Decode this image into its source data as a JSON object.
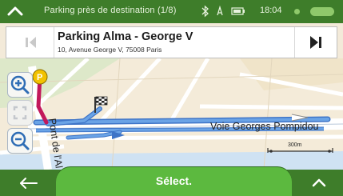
{
  "status_bar": {
    "title": "Parking près de destination (1/8)",
    "time": "18:04",
    "icons": [
      "chevron-up-icon",
      "bluetooth-icon",
      "gps-icon",
      "battery-icon",
      "gps-status-dot",
      "signal-pill"
    ]
  },
  "poi": {
    "name": "Parking Alma - George V",
    "address": "10, Avenue George V, 75008 Paris"
  },
  "map": {
    "road_label_horizontal": "Voie Georges Pompidou",
    "road_label_vertical": "Pont de l'Al",
    "scale_label": "300m",
    "controls": [
      "zoom-in-icon",
      "fit-view-icon",
      "zoom-out-icon"
    ],
    "colors": {
      "route": "#6aa3e6",
      "route_outline": "#3e74c7",
      "highlight_route": "#c2185b",
      "parking_marker": "#f2c200",
      "park_area": "#dbe7c9",
      "river": "#c9dff5"
    }
  },
  "bottom_bar": {
    "select_label": "Sélect.",
    "back_icon": "back-arrow-icon",
    "more_icon": "chevron-up-icon"
  },
  "colors": {
    "bar_green": "#3e7d2a",
    "button_green": "#5cb93f"
  }
}
